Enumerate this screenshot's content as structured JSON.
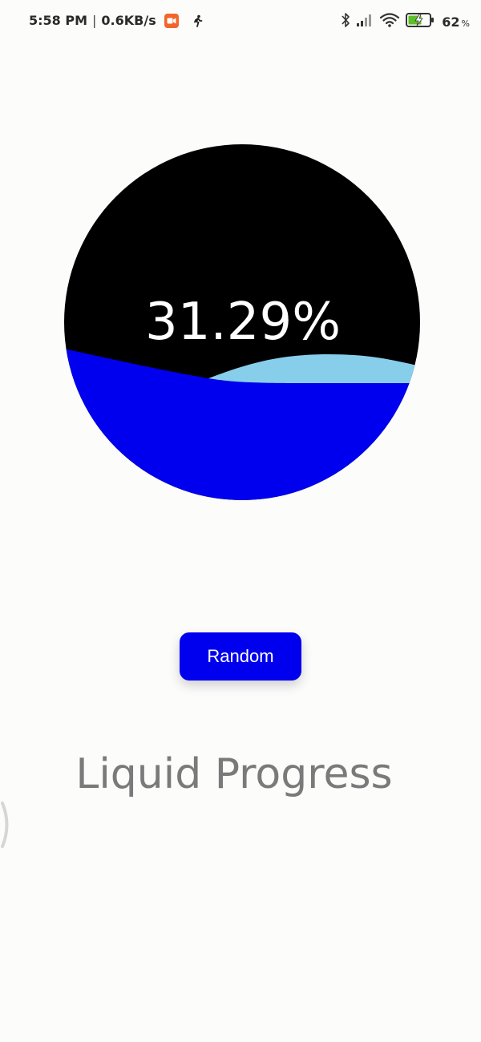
{
  "status_bar": {
    "time": "5:58 PM",
    "separator": "|",
    "network_speed": "0.6KB/s",
    "battery_level": "62",
    "battery_unit": "%",
    "icons": [
      "screen-record-icon",
      "walking-person-icon",
      "bluetooth-icon",
      "signal-icon",
      "wifi-icon",
      "battery-charging-icon"
    ]
  },
  "liquid_progress": {
    "progress_text": "31.29%",
    "value": 31.29,
    "colors": {
      "background": "#000000",
      "front_wave": "#0000ee",
      "back_wave": "#87ceeb"
    }
  },
  "random_button": {
    "label": "Random",
    "color": "#0000ee"
  },
  "title": "Liquid Progress"
}
